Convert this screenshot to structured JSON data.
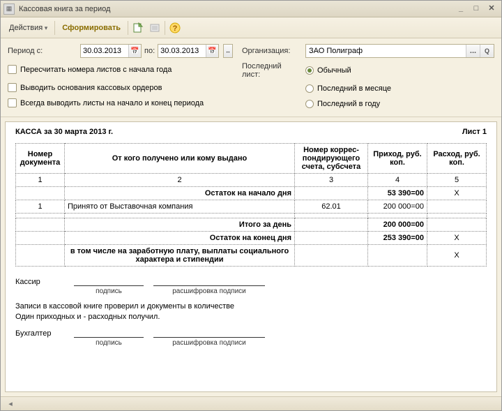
{
  "window": {
    "title": "Кассовая книга за период"
  },
  "toolbar": {
    "actions": "Действия",
    "form": "Сформировать"
  },
  "form": {
    "period_label": "Период с:",
    "date_from": "30.03.2013",
    "to_label": "по:",
    "date_to": "30.03.2013",
    "org_label": "Организация:",
    "org_value": "ЗАО Полиграф",
    "recalc": "Пересчитать номера листов с начала года",
    "print_basis": "Выводить основания кассовых ордеров",
    "always_sheets": "Всегда выводить листы на начало и конец периода",
    "last_sheet_label": "Последний лист:",
    "radio_normal": "Обычный",
    "radio_month": "Последний в месяце",
    "radio_year": "Последний в году"
  },
  "report": {
    "title": "КАССА за 30 марта 2013 г.",
    "sheet": "Лист 1",
    "col_doc": "Номер документа",
    "col_who": "От кого получено или кому выдано",
    "col_corr": "Номер коррес-пондирующего счета, субсчета",
    "col_in": "Приход, руб. коп.",
    "col_out": "Расход, руб. коп.",
    "n1": "1",
    "n2": "2",
    "n3": "3",
    "n4": "4",
    "n5": "5",
    "open_balance_label": "Остаток на начало дня",
    "open_balance_in": "53 390=00",
    "open_balance_out": "Х",
    "row1_doc": "1",
    "row1_who": "Принято от Выставочная компания",
    "row1_corr": "62.01",
    "row1_in": "200 000=00",
    "total_day_label": "Итого за день",
    "total_day_in": "200 000=00",
    "close_balance_label": "Остаток на конец  дня",
    "close_balance_in": "253 390=00",
    "close_balance_out": "Х",
    "incl_label": "в том числе на заработную плату, выплаты социального характера и стипендии",
    "incl_out": "Х",
    "cashier": "Кассир",
    "sign": "подпись",
    "decipher": "расшифровка подписи",
    "note1": "Записи в кассовой книге проверил и документы в количестве",
    "note2": "Один приходных и  - расходных получил.",
    "accountant": "Бухгалтер"
  }
}
